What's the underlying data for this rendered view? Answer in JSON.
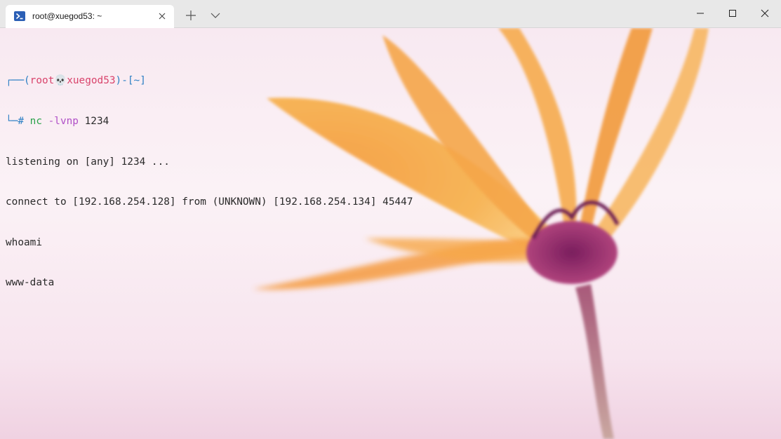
{
  "window": {
    "tab_title": "root@xuegod53: ~",
    "tab_icon": "powershell-icon",
    "controls": [
      "minimize-icon",
      "maximize-icon",
      "close-icon"
    ]
  },
  "terminal": {
    "prompt": {
      "box_top": "┌──(",
      "user": "root",
      "skull": "💀",
      "host": "xuegod53",
      "mid": ")-[",
      "path": "~",
      "end": "]",
      "box_bottom": "└─",
      "hash": "# ",
      "command": "nc",
      "args": " -lvnp",
      "port": " 1234"
    },
    "output": [
      "listening on [any] 1234 ...",
      "connect to [192.168.254.128] from (UNKNOWN) [192.168.254.134] 45447",
      "whoami",
      "www-data"
    ]
  },
  "colors": {
    "accent_blue": "#2c7fc4",
    "user_red": "#d9436b",
    "command_green": "#2aa24a",
    "arg_purple": "#b04fc7"
  }
}
